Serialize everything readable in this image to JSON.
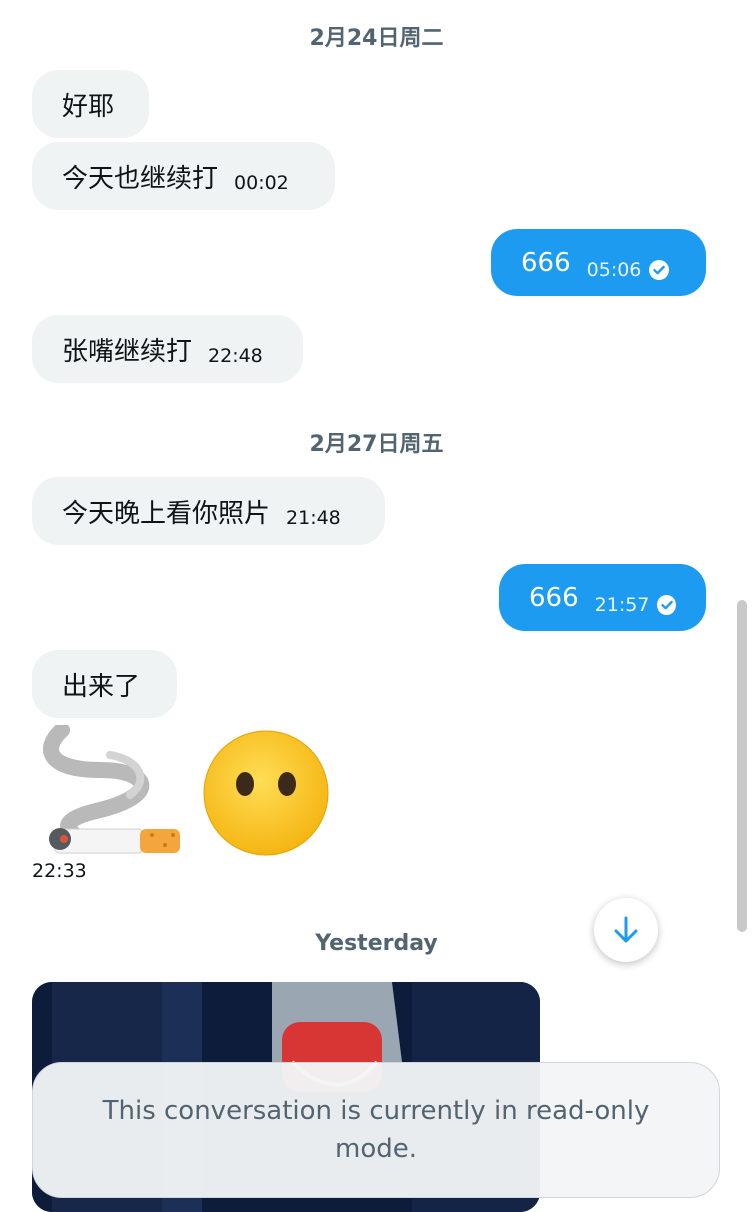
{
  "dates": {
    "d1": "2月24日周二",
    "d2": "2月27日周五",
    "d3": "Yesterday"
  },
  "messages": [
    {
      "dir": "in",
      "text": "好耶",
      "time": ""
    },
    {
      "dir": "in",
      "text": "今天也继续打",
      "time": "00:02"
    },
    {
      "dir": "out",
      "text": "666",
      "time": "05:06"
    },
    {
      "dir": "in",
      "text": "张嘴继续打",
      "time": "22:48"
    },
    {
      "dir": "in",
      "text": "今天晚上看你照片",
      "time": "21:48"
    },
    {
      "dir": "out",
      "text": "666",
      "time": "21:57"
    },
    {
      "dir": "in",
      "text": "出来了",
      "time": ""
    }
  ],
  "emoji_message": {
    "icons": [
      "cigarette-icon",
      "face-without-mouth-icon"
    ],
    "time": "22:33"
  },
  "banner": {
    "text": "This conversation is currently in read-only mode."
  },
  "colors": {
    "outgoing": "#1d9bf0",
    "incoming": "#eff3f4",
    "muted": "#536471"
  }
}
